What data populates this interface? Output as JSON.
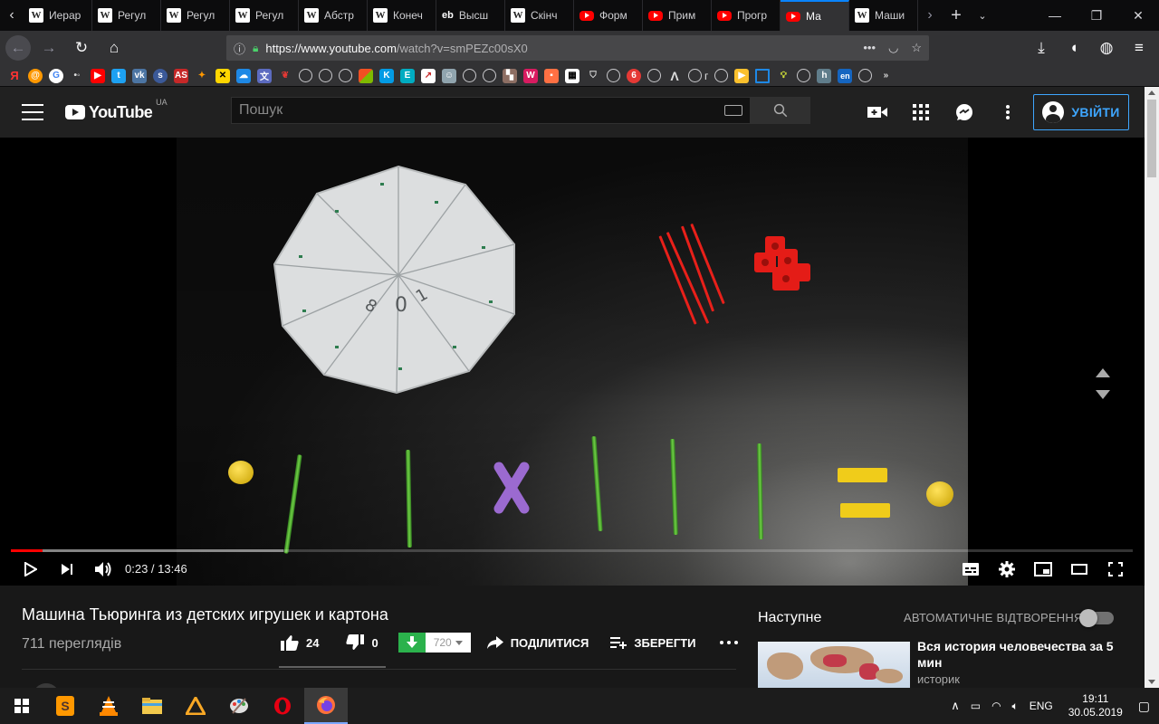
{
  "browser": {
    "tabs": [
      {
        "label": "Иерар",
        "icon": "wikipedia"
      },
      {
        "label": "Регул",
        "icon": "wikipedia"
      },
      {
        "label": "Регул",
        "icon": "wikipedia"
      },
      {
        "label": "Регул",
        "icon": "wikipedia"
      },
      {
        "label": "Абстр",
        "icon": "wikipedia"
      },
      {
        "label": "Конеч",
        "icon": "wikipedia"
      },
      {
        "label": "Высш",
        "icon": "eb"
      },
      {
        "label": "Скінч",
        "icon": "wikipedia"
      },
      {
        "label": "Форм",
        "icon": "youtube"
      },
      {
        "label": "Прим",
        "icon": "youtube"
      },
      {
        "label": "Прогр",
        "icon": "youtube"
      },
      {
        "label": "Ма",
        "icon": "youtube"
      },
      {
        "label": "Маши",
        "icon": "wikipedia"
      }
    ],
    "active_tab_index": 11,
    "eb_favicon_text": "eb",
    "wiki_favicon_text": "W",
    "url_host": "https://www.youtube.com",
    "url_path": "/watch?v=smPEZc00sX0",
    "bookmark_bar": {
      "letter_bookmark": "г"
    }
  },
  "youtube": {
    "logo_text": "YouTube",
    "country_code": "UA",
    "search_placeholder": "Пошук",
    "sign_in_label": "УВІЙТИ"
  },
  "player": {
    "current_time": "0:23",
    "duration": "13:46",
    "time_display": "0:23 / 13:46",
    "played_fraction": 0.028,
    "buffered_fraction": 0.243
  },
  "video": {
    "title": "Машина Тьюринга из детских игрушек и картона",
    "views": "711 переглядів",
    "likes": "24",
    "dislikes": "0",
    "download_quality": "720",
    "share_label": "ПОДІЛИТИСЯ",
    "save_label": "ЗБЕРЕГТИ"
  },
  "sidebar": {
    "up_next_label": "Наступне",
    "autoplay_label": "АВТОМАТИЧНЕ ВІДТВОРЕННЯ",
    "autoplay_on": false,
    "next_video": {
      "title": "Вся история человечества за 5 мин",
      "channel": "историк"
    }
  },
  "taskbar": {
    "language": "ENG",
    "time": "19:11",
    "date": "30.05.2019"
  },
  "colors": {
    "accent_blue": "#3ea6ff",
    "youtube_red": "#ff0000",
    "download_green": "#2bb24c"
  }
}
